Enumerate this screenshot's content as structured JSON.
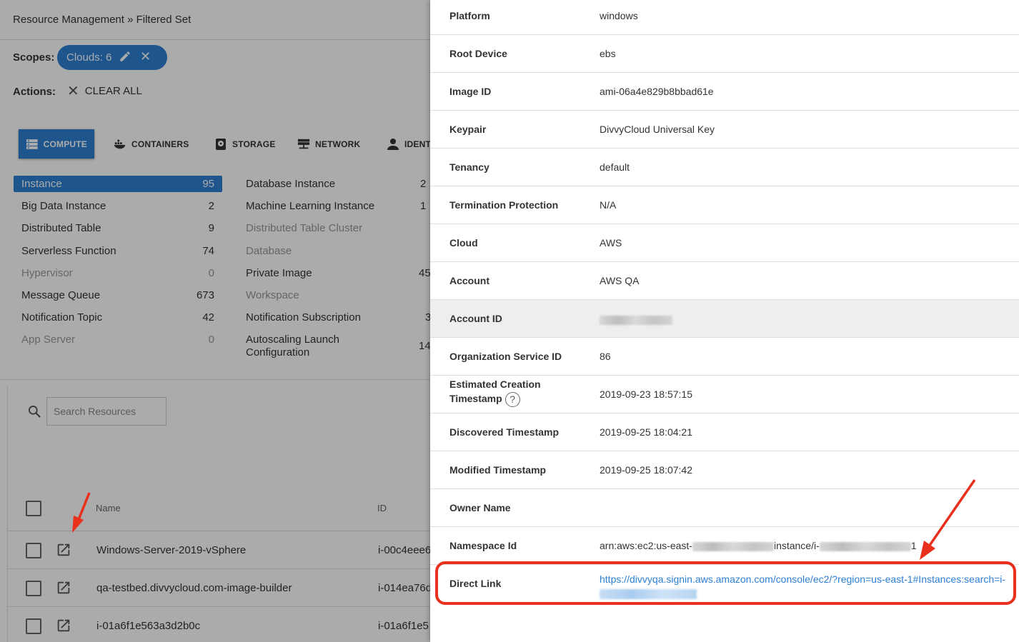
{
  "breadcrumb": "Resource Management » Filtered Set",
  "scopes": {
    "label": "Scopes:",
    "pill": "Clouds: 6"
  },
  "actions": {
    "label": "Actions:",
    "clear_all": "CLEAR ALL"
  },
  "tabs": [
    {
      "label": "COMPUTE",
      "active": true,
      "icon": "compute-icon"
    },
    {
      "label": "CONTAINERS",
      "icon": "docker-icon"
    },
    {
      "label": "STORAGE",
      "icon": "storage-icon"
    },
    {
      "label": "NETWORK",
      "icon": "network-icon"
    },
    {
      "label": "IDENT",
      "icon": "user-icon"
    }
  ],
  "resource_types": {
    "col1": [
      {
        "name": "Instance",
        "count": "95",
        "active": true
      },
      {
        "name": "Big Data Instance",
        "count": "2"
      },
      {
        "name": "Distributed Table",
        "count": "9"
      },
      {
        "name": "Serverless Function",
        "count": "74"
      },
      {
        "name": "Hypervisor",
        "count": "0",
        "dim": true
      },
      {
        "name": "Message Queue",
        "count": "673"
      },
      {
        "name": "Notification Topic",
        "count": "42"
      },
      {
        "name": "App Server",
        "count": "0",
        "dim": true
      }
    ],
    "col2": [
      {
        "name": "Database Instance",
        "count": "2"
      },
      {
        "name": "Machine Learning Instance",
        "count": "1"
      },
      {
        "name": "Distributed Table Cluster",
        "count": "",
        "dim": true
      },
      {
        "name": "Database",
        "count": "",
        "dim": true
      },
      {
        "name": "Private Image",
        "count": "45"
      },
      {
        "name": "Workspace",
        "count": "",
        "dim": true
      },
      {
        "name": "Notification Subscription",
        "count": "3"
      },
      {
        "name": "Autoscaling Launch Configuration",
        "count": "14"
      }
    ]
  },
  "search": {
    "placeholder": "Search Resources"
  },
  "table": {
    "col_name": "Name",
    "col_id": "ID",
    "rows": [
      {
        "name": "Windows-Server-2019-vSphere",
        "id": "i-00c4eee6"
      },
      {
        "name": "qa-testbed.divvycloud.com-image-builder",
        "id": "i-014ea76d"
      },
      {
        "name": "i-01a6f1e563a3d2b0c",
        "id": "i-01a6f1e5"
      }
    ]
  },
  "details": [
    {
      "label": "Platform",
      "value": "windows"
    },
    {
      "label": "Root Device",
      "value": "ebs"
    },
    {
      "label": "Image ID",
      "value": "ami-06a4e829b8bbad61e"
    },
    {
      "label": "Keypair",
      "value": "DivvyCloud Universal Key"
    },
    {
      "label": "Tenancy",
      "value": "default"
    },
    {
      "label": "Termination Protection",
      "value": "N/A"
    },
    {
      "label": "Cloud",
      "value": "AWS"
    },
    {
      "label": "Account",
      "value": "AWS QA"
    },
    {
      "label": "Account ID",
      "value": ""
    },
    {
      "label": "Organization Service ID",
      "value": "86"
    },
    {
      "label": "Estimated Creation Timestamp",
      "label_line1": "Estimated Creation",
      "label_line2": "Timestamp",
      "value": "2019-09-23 18:57:15"
    },
    {
      "label": "Discovered Timestamp",
      "value": "2019-09-25 18:04:21"
    },
    {
      "label": "Modified Timestamp",
      "value": "2019-09-25 18:07:42"
    },
    {
      "label": "Owner Name",
      "value": ""
    },
    {
      "label": "Namespace Id",
      "value_prefix": "arn:aws:ec2:us-east-",
      "value_mid": "instance/i-",
      "value_suffix": "1"
    },
    {
      "label": "Direct Link",
      "value": "https://divvyqa.signin.aws.amazon.com/console/ec2/?region=us-east-1#Instances:search=i-"
    }
  ],
  "help_glyph": "?",
  "colors": {
    "accent": "#2d7fd3",
    "annotation": "#e8301c"
  }
}
